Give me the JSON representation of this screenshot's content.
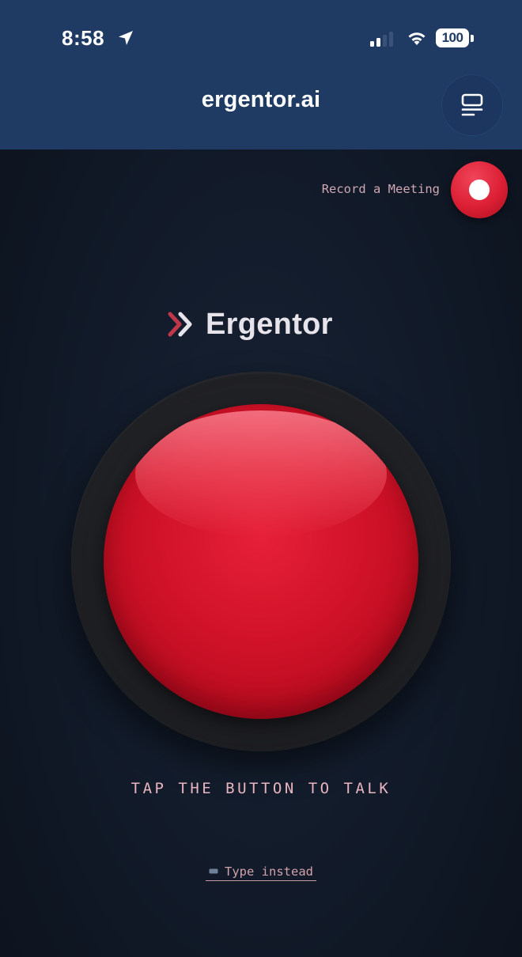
{
  "status_bar": {
    "time": "8:58",
    "battery": "100",
    "location_icon": "location-arrow-icon",
    "signal_icon": "cellular-signal-icon",
    "wifi_icon": "wifi-icon"
  },
  "header": {
    "title": "ergentor.ai",
    "menu_icon": "menu-list-icon",
    "background_color": "#1f3b63"
  },
  "record_meeting": {
    "label": "Record a Meeting",
    "icon": "record-icon",
    "color": "#dc1f34"
  },
  "brand": {
    "name": "Ergentor",
    "icon": "double-chevron-right-icon"
  },
  "main_button": {
    "color": "#d01228"
  },
  "instruction": "TAP THE BUTTON TO TALK",
  "type_instead": {
    "label": "Type instead",
    "icon": "keyboard-icon"
  }
}
